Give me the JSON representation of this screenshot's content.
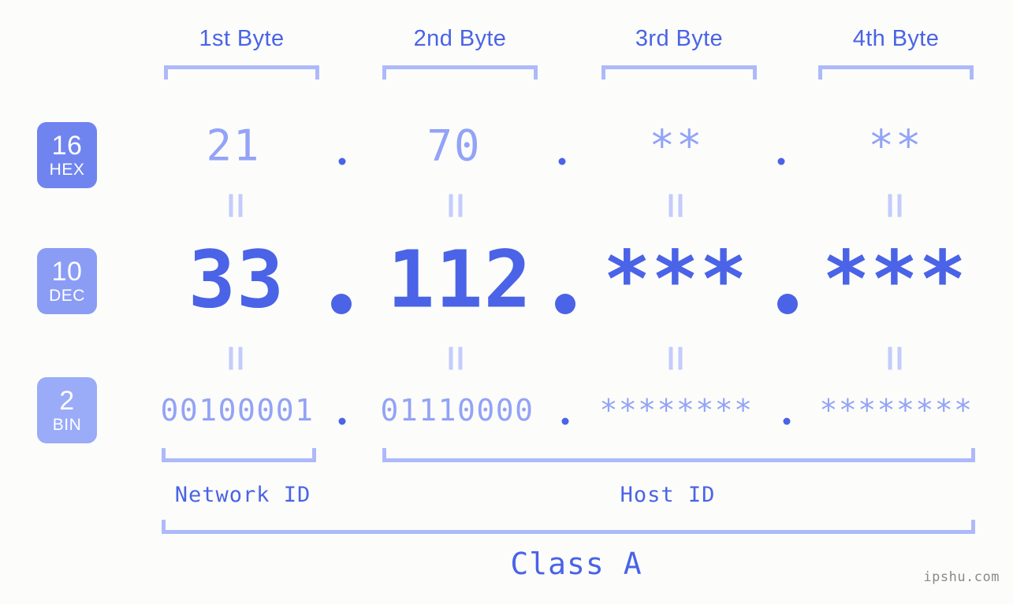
{
  "meta": {
    "background_color": "#fcfdfa",
    "accent_color": "#4a63e7",
    "light_accent_color": "#93a3f7",
    "bracket_color": "#aeb9fb",
    "eq_color": "#c3ccfc",
    "watermark": "ipshu.com"
  },
  "headers": [
    {
      "label": "1st Byte"
    },
    {
      "label": "2nd Byte"
    },
    {
      "label": "3rd Byte"
    },
    {
      "label": "4th Byte"
    }
  ],
  "bases": [
    {
      "number": "16",
      "name": "HEX",
      "color": "#7084f0"
    },
    {
      "number": "10",
      "name": "DEC",
      "color": "#8b9cf5"
    },
    {
      "number": "2",
      "name": "BIN",
      "color": "#9aabf8"
    }
  ],
  "rows": {
    "hex": {
      "values": [
        "21",
        "70",
        "**",
        "**"
      ],
      "separator": "."
    },
    "dec": {
      "values": [
        "33",
        "112",
        "***",
        "***"
      ],
      "separator": "."
    },
    "bin": {
      "values": [
        "00100001",
        "01110000",
        "********",
        "********"
      ],
      "separator": "."
    }
  },
  "equals_symbol": "=",
  "sections": [
    {
      "label": "Network ID"
    },
    {
      "label": "Host ID"
    }
  ],
  "class": {
    "label": "Class A"
  }
}
